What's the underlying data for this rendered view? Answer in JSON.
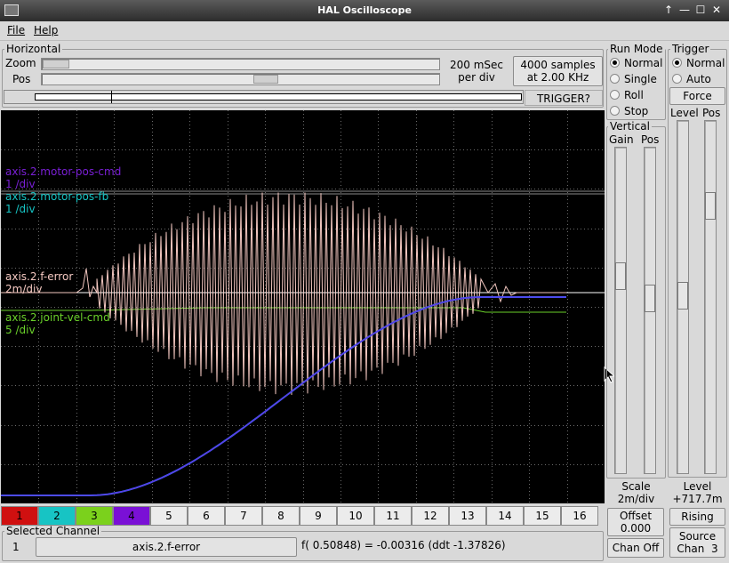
{
  "window": {
    "title": "HAL Oscilloscope",
    "controls": [
      "↑",
      "—",
      "☐",
      "✕"
    ]
  },
  "menu": {
    "file": "File",
    "help": "Help"
  },
  "horizontal": {
    "legend": "Horizontal",
    "zoom_label": "Zoom",
    "pos_label": "Pos",
    "rate_line1": "200 mSec",
    "rate_line2": "per div",
    "samples_line1": "4000 samples",
    "samples_line2": "at 2.00 KHz",
    "trigger_status": "TRIGGER?"
  },
  "run_mode": {
    "legend": "Run Mode",
    "options": [
      {
        "label": "Normal",
        "selected": true
      },
      {
        "label": "Single",
        "selected": false
      },
      {
        "label": "Roll",
        "selected": false
      },
      {
        "label": "Stop",
        "selected": false
      }
    ]
  },
  "vertical": {
    "legend": "Vertical",
    "gain_label": "Gain",
    "pos_label": "Pos",
    "scale_label": "Scale",
    "scale_value": "2m/div",
    "offset_label": "Offset",
    "offset_value": "0.000",
    "chan_off": "Chan Off"
  },
  "trigger": {
    "legend": "Trigger",
    "options": [
      {
        "label": "Normal",
        "selected": true
      },
      {
        "label": "Auto",
        "selected": false
      }
    ],
    "force": "Force",
    "level_label": "Level",
    "pos_label": "Pos",
    "level_caption": "Level",
    "level_value": "+717.7m",
    "edge": "Rising",
    "source_line1": "Source",
    "source_line2": "Chan  3"
  },
  "traces": [
    {
      "name": "axis.2.motor-pos-cmd",
      "scale": "1 /div",
      "color": "#7a1fd6"
    },
    {
      "name": "axis.2.motor-pos-fb",
      "scale": "1 /div",
      "color": "#16c4c4"
    },
    {
      "name": "axis.2.f-error",
      "scale": "2m/div",
      "color": "#f3c7c0"
    },
    {
      "name": "axis.2.joint-vel-cmd",
      "scale": "5 /div",
      "color": "#6ad12a"
    }
  ],
  "channels": [
    {
      "num": "1",
      "color": "#d01010"
    },
    {
      "num": "2",
      "color": "#17c4c4"
    },
    {
      "num": "3",
      "color": "#7bd11c"
    },
    {
      "num": "4",
      "color": "#7a10d6"
    },
    {
      "num": "5",
      "color": ""
    },
    {
      "num": "6",
      "color": ""
    },
    {
      "num": "7",
      "color": ""
    },
    {
      "num": "8",
      "color": ""
    },
    {
      "num": "9",
      "color": ""
    },
    {
      "num": "10",
      "color": ""
    },
    {
      "num": "11",
      "color": ""
    },
    {
      "num": "12",
      "color": ""
    },
    {
      "num": "13",
      "color": ""
    },
    {
      "num": "14",
      "color": ""
    },
    {
      "num": "15",
      "color": ""
    },
    {
      "num": "16",
      "color": ""
    }
  ],
  "selected_channel": {
    "legend": "Selected Channel",
    "number": "1",
    "name": "axis.2.f-error",
    "readout": "f( 0.50848) = -0.00316 (ddt -1.37826)"
  }
}
